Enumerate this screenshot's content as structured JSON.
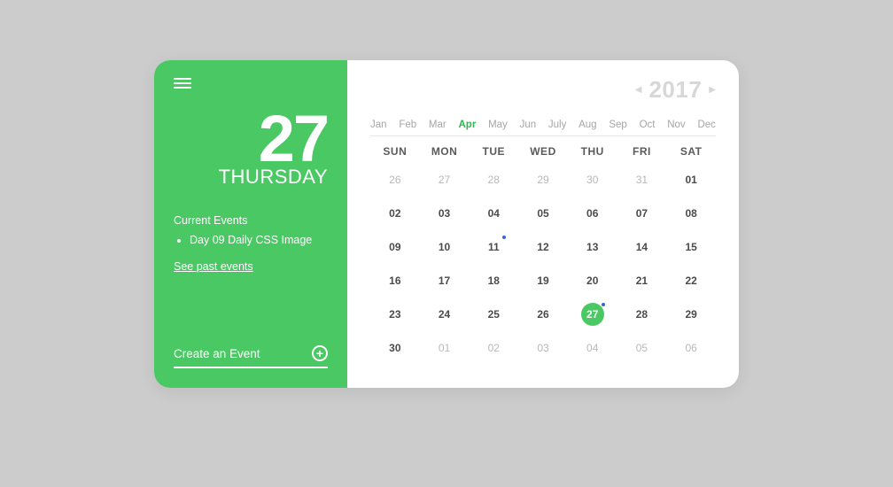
{
  "accent": "#4ac864",
  "left": {
    "day_number": "27",
    "day_name": "THURSDAY",
    "events_heading": "Current Events",
    "events": [
      "Day 09 Daily CSS Image"
    ],
    "see_past": "See past events",
    "create_label": "Create an Event"
  },
  "year": {
    "value": "2017"
  },
  "months": [
    "Jan",
    "Feb",
    "Mar",
    "Apr",
    "May",
    "Jun",
    "July",
    "Aug",
    "Sep",
    "Oct",
    "Nov",
    "Dec"
  ],
  "active_month_index": 3,
  "dow": [
    "SUN",
    "MON",
    "TUE",
    "WED",
    "THU",
    "FRI",
    "SAT"
  ],
  "days": [
    {
      "n": "26",
      "trail": true
    },
    {
      "n": "27",
      "trail": true
    },
    {
      "n": "28",
      "trail": true
    },
    {
      "n": "29",
      "trail": true
    },
    {
      "n": "30",
      "trail": true
    },
    {
      "n": "31",
      "trail": true
    },
    {
      "n": "01"
    },
    {
      "n": "02"
    },
    {
      "n": "03"
    },
    {
      "n": "04"
    },
    {
      "n": "05"
    },
    {
      "n": "06"
    },
    {
      "n": "07"
    },
    {
      "n": "08"
    },
    {
      "n": "09"
    },
    {
      "n": "10"
    },
    {
      "n": "11",
      "dot": true
    },
    {
      "n": "12"
    },
    {
      "n": "13"
    },
    {
      "n": "14"
    },
    {
      "n": "15"
    },
    {
      "n": "16"
    },
    {
      "n": "17"
    },
    {
      "n": "18"
    },
    {
      "n": "19"
    },
    {
      "n": "20"
    },
    {
      "n": "21"
    },
    {
      "n": "22"
    },
    {
      "n": "23"
    },
    {
      "n": "24"
    },
    {
      "n": "25"
    },
    {
      "n": "26"
    },
    {
      "n": "27",
      "selected": true,
      "dot": true
    },
    {
      "n": "28"
    },
    {
      "n": "29"
    },
    {
      "n": "30"
    },
    {
      "n": "01",
      "trail": true
    },
    {
      "n": "02",
      "trail": true
    },
    {
      "n": "03",
      "trail": true
    },
    {
      "n": "04",
      "trail": true
    },
    {
      "n": "05",
      "trail": true
    },
    {
      "n": "06",
      "trail": true
    }
  ]
}
